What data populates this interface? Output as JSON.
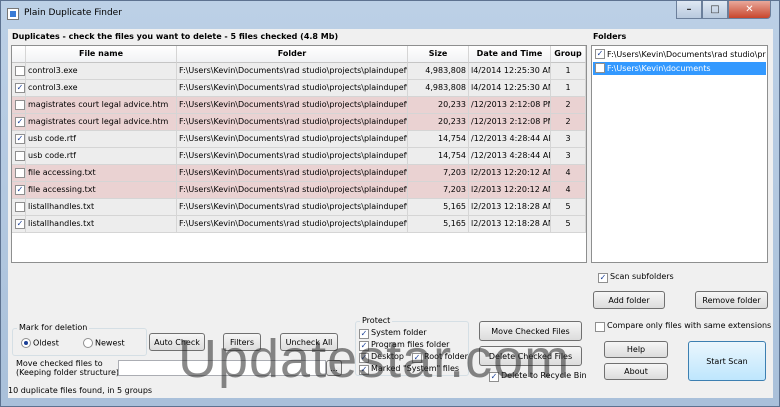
{
  "window": {
    "title": "Plain Duplicate Finder"
  },
  "duplicates_header": "Duplicates - check the files you want to delete - 5 files checked (4.8 Mb)",
  "columns": [
    "File name",
    "Folder",
    "Size",
    "Date and Time",
    "Group"
  ],
  "rows": [
    {
      "checked": false,
      "name": "control3.exe",
      "folder": "F:\\Users\\Kevin\\Documents\\rad studio\\projects\\plaindupefind",
      "size": "4,983,808",
      "date": "l4/2014 12:25:30 AM",
      "group": "1",
      "color": "#ededed"
    },
    {
      "checked": true,
      "name": "control3.exe",
      "folder": "F:\\Users\\Kevin\\Documents\\rad studio\\projects\\plaindupefind",
      "size": "4,983,808",
      "date": "l4/2014 12:25:30 AM",
      "group": "1",
      "color": "#ededed"
    },
    {
      "checked": false,
      "name": "magistrates court   legal advice.htm",
      "folder": "F:\\Users\\Kevin\\Documents\\rad studio\\projects\\plaindupefind",
      "size": "20,233",
      "date": "/12/2013 2:12:08 PM",
      "group": "2",
      "color": "#ead2d2"
    },
    {
      "checked": true,
      "name": "magistrates court   legal advice.htm",
      "folder": "F:\\Users\\Kevin\\Documents\\rad studio\\projects\\plaindupefind",
      "size": "20,233",
      "date": "/12/2013 2:12:08 PM",
      "group": "2",
      "color": "#ead2d2"
    },
    {
      "checked": true,
      "name": "usb code.rtf",
      "folder": "F:\\Users\\Kevin\\Documents\\rad studio\\projects\\plaindupefind",
      "size": "14,754",
      "date": "/12/2013 4:28:44 AM",
      "group": "3",
      "color": "#ededed"
    },
    {
      "checked": false,
      "name": "usb code.rtf",
      "folder": "F:\\Users\\Kevin\\Documents\\rad studio\\projects\\plaindupefind",
      "size": "14,754",
      "date": "/12/2013 4:28:44 AM",
      "group": "3",
      "color": "#ededed"
    },
    {
      "checked": false,
      "name": "file accessing.txt",
      "folder": "F:\\Users\\Kevin\\Documents\\rad studio\\projects\\plaindupefind",
      "size": "7,203",
      "date": "l2/2013 12:20:12 AM",
      "group": "4",
      "color": "#ead2d2"
    },
    {
      "checked": true,
      "name": "file accessing.txt",
      "folder": "F:\\Users\\Kevin\\Documents\\rad studio\\projects\\plaindupefind",
      "size": "7,203",
      "date": "l2/2013 12:20:12 AM",
      "group": "4",
      "color": "#ead2d2"
    },
    {
      "checked": false,
      "name": "listallhandles.txt",
      "folder": "F:\\Users\\Kevin\\Documents\\rad studio\\projects\\plaindupefind",
      "size": "5,165",
      "date": "l2/2013 12:18:28 AM",
      "group": "5",
      "color": "#ededed"
    },
    {
      "checked": true,
      "name": "listallhandles.txt",
      "folder": "F:\\Users\\Kevin\\Documents\\rad studio\\projects\\plaindupefind",
      "size": "5,165",
      "date": "l2/2013 12:18:28 AM",
      "group": "5",
      "color": "#ededed"
    }
  ],
  "folders": {
    "title": "Folders",
    "items": [
      {
        "checked": true,
        "path": "F:\\Users\\Kevin\\Documents\\rad studio\\proje",
        "selected": false
      },
      {
        "checked": false,
        "path": "F:\\Users\\Kevin\\documents",
        "selected": true
      }
    ],
    "scan_subfolders": {
      "label": "Scan subfolders",
      "checked": true
    },
    "add_label": "Add folder",
    "remove_label": "Remove folder"
  },
  "mark": {
    "label": "Mark for deletion",
    "oldest": "Oldest",
    "newest": "Newest",
    "selected": "oldest"
  },
  "buttons": {
    "auto_check": "Auto Check",
    "filters": "Filters",
    "uncheck_all": "Uncheck All",
    "move_checked": "Move Checked Files",
    "delete_checked": "Delete Checked Files",
    "help": "Help",
    "about": "About",
    "start_scan": "Start Scan"
  },
  "move": {
    "label1": "Move checked files to",
    "label2": "(Keeping folder structure)"
  },
  "protect": {
    "label": "Protect",
    "system_folder": "System folder",
    "program_files": "Program files folder",
    "desktop": "Desktop",
    "root_folder": "Root folder",
    "marked_system": "Marked \"System\" files"
  },
  "compare_ext": {
    "label": "Compare only files with same extensions",
    "checked": false
  },
  "recycle": {
    "label": "Delete to Recycle Bin",
    "checked": true
  },
  "status": "10 duplicate files found, in 5 groups",
  "watermark": "Updatestar.com"
}
